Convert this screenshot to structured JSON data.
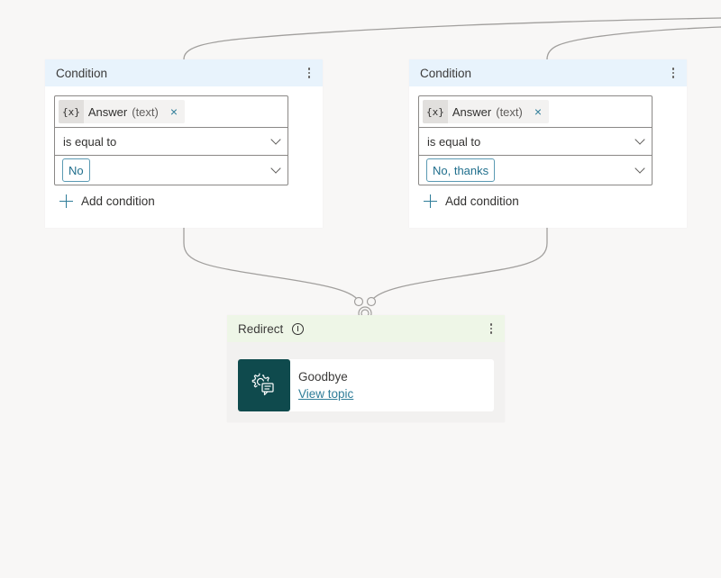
{
  "conditions": [
    {
      "title": "Condition",
      "variable": {
        "icon": "{x}",
        "name": "Answer",
        "type": "(text)",
        "remove_icon": "×"
      },
      "operator": "is equal to",
      "value": "No",
      "add_label": "Add condition"
    },
    {
      "title": "Condition",
      "variable": {
        "icon": "{x}",
        "name": "Answer",
        "type": "(text)",
        "remove_icon": "×"
      },
      "operator": "is equal to",
      "value": "No, thanks",
      "add_label": "Add condition"
    }
  ],
  "redirect": {
    "title": "Redirect",
    "topic_name": "Goodbye",
    "topic_link": "View topic"
  },
  "colors": {
    "canvas": "#f8f7f6",
    "condition_header": "#e8f3fc",
    "redirect_header": "#eef6e7",
    "accent": "#2f7d99",
    "topic_icon_bg": "#0f4a4d",
    "connector": "#a19f9d"
  }
}
